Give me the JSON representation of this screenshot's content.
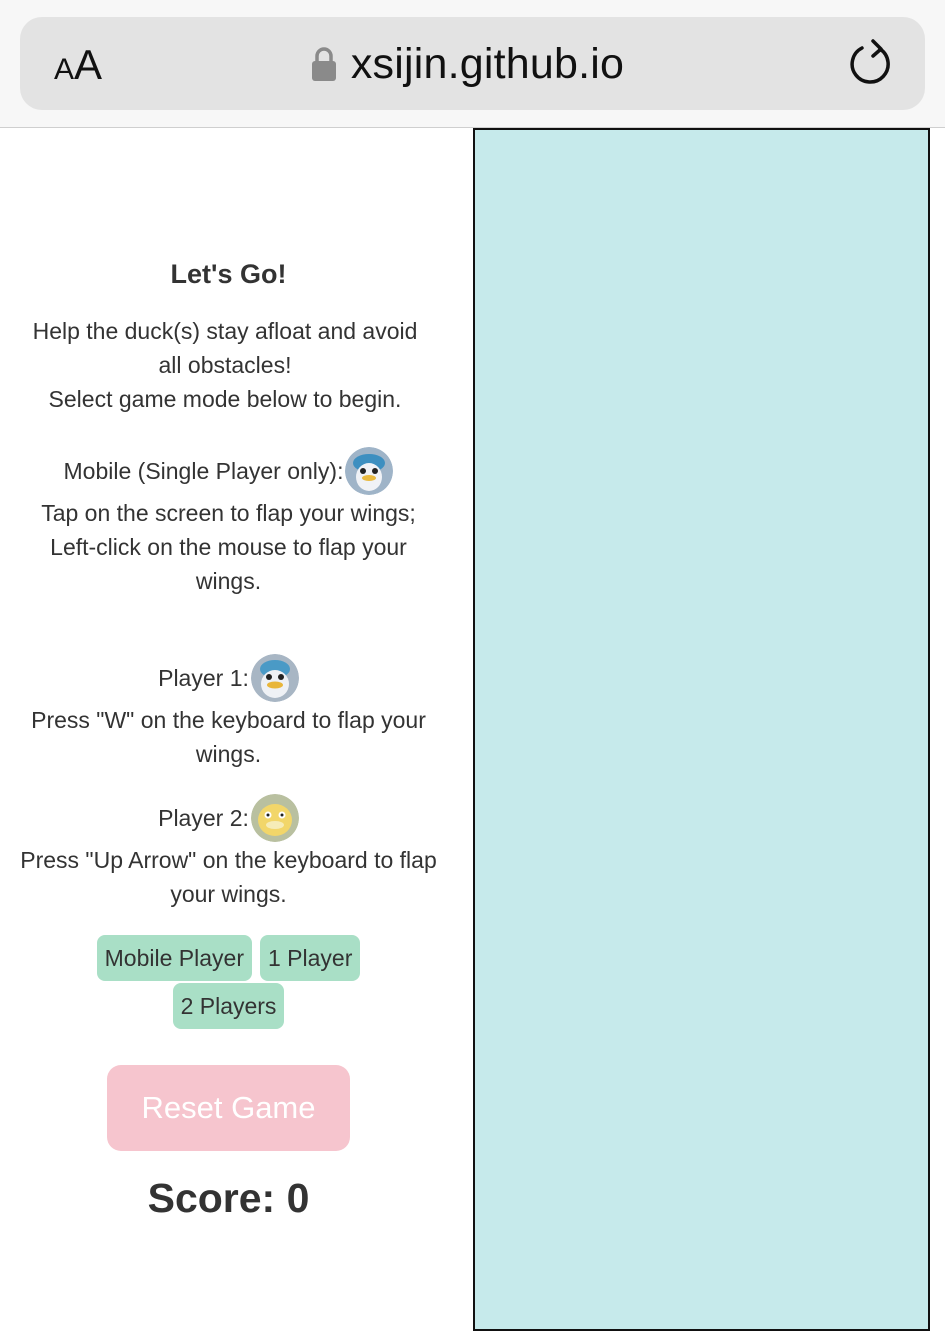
{
  "browser": {
    "text_size_small": "A",
    "text_size_big": "A",
    "url": "xsijin.github.io",
    "lock_icon": "lock-icon",
    "reload_icon": "reload-icon"
  },
  "panel": {
    "title": "Let's Go!",
    "intro_line1": "Help the duck(s) stay afloat and avoid all obstacles!",
    "intro_line2": "Select game mode below to begin.",
    "mobile": {
      "heading": "Mobile (Single Player only):",
      "line1": "Tap on the screen to flap your wings;",
      "line2": "Left-click on the mouse to flap your wings."
    },
    "player1": {
      "heading": "Player 1:",
      "line1": "Press \"W\" on the keyboard to flap your wings."
    },
    "player2": {
      "heading": "Player 2:",
      "line1": "Press \"Up Arrow\" on the keyboard to flap your wings."
    },
    "mode_buttons": [
      "Mobile Player",
      "1 Player",
      "2 Players"
    ],
    "reset_label": "Reset Game",
    "score_label": "Score: 0"
  },
  "colors": {
    "mode_button": "#a9dfc6",
    "reset_button": "#f6c5ce",
    "canvas": "#c6eaeb"
  }
}
